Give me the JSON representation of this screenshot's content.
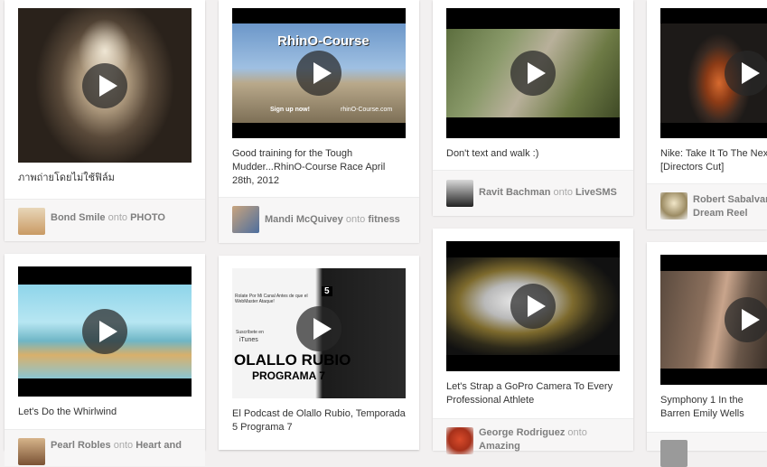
{
  "pins": [
    {
      "description": "ภาพถ่ายโดยไม่ใช้ฟิล์ม",
      "user": "Bond Smile",
      "onto": "onto",
      "board": "PHOTO",
      "thumb": "portrait-photo"
    },
    {
      "description": "Good training for the Tough Mudder...RhinO-Course Race April 28th, 2012",
      "user": "Mandi McQuivey",
      "onto": "onto",
      "board": "fitness",
      "thumb": "rhino-course"
    },
    {
      "description": "Don't text and walk :)",
      "user": "Ravit Bachman",
      "onto": "onto",
      "board": "LiveSMS",
      "thumb": "aerial-street"
    },
    {
      "description": "Nike: Take It To The Next Level [Directors Cut]",
      "user": "Robert Sabalvaro",
      "onto": "onto",
      "board": "Dream Reel",
      "thumb": "nike-soccer"
    },
    {
      "description": "Let's Do the Whirlwind",
      "user": "Pearl Robles",
      "onto": "onto",
      "board": "Heart and",
      "thumb": "cartoon-raft"
    },
    {
      "description": "El Podcast de Olallo Rubio, Temporada 5 Programa 7",
      "user": "",
      "onto": "",
      "board": "",
      "thumb": "olallo-rubio",
      "thumb_text": {
        "top": "Rolate Por Mi Canal Antes de que el WebMaster Ataque!",
        "subscribe": "Suscríbete en",
        "itunes": "iTunes",
        "title": "OLALLO RUBIO",
        "subtitle": "PROGRAMA 7",
        "badge": "5"
      }
    },
    {
      "description": "Let's Strap a GoPro Camera To Every Professional Athlete",
      "user": "George Rodriguez",
      "onto": "onto",
      "board": "Amazing",
      "thumb": "gopro-lacrosse"
    },
    {
      "description": "Symphony 1 In the Barren Emily Wells",
      "user": "",
      "onto": "",
      "board": "",
      "thumb": "violin-studio"
    }
  ],
  "rhino_overlay": {
    "title": "RhinO-Course",
    "signup": "Sign up now!",
    "url": "rhinO-Course.com"
  }
}
